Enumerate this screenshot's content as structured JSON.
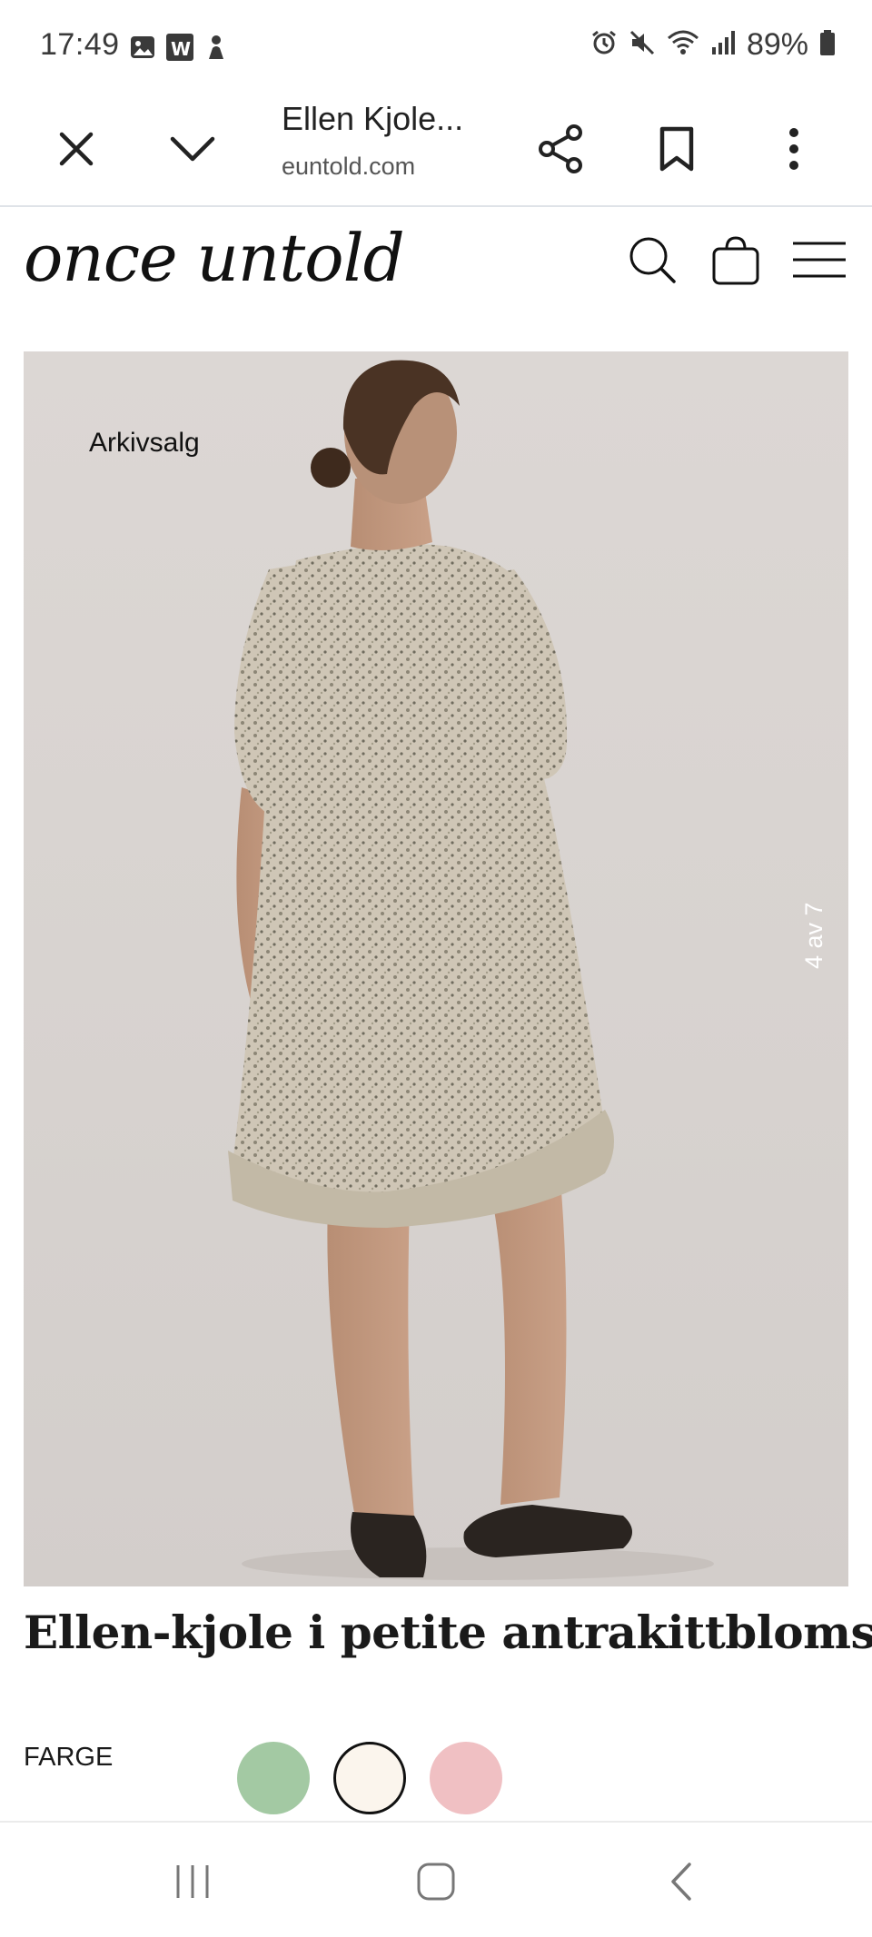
{
  "status_bar": {
    "time": "17:49",
    "left_icons": [
      "gallery-icon",
      "app-badge-icon",
      "activity-icon"
    ],
    "right_icons": [
      "alarm-icon",
      "mute-icon",
      "wifi-icon",
      "signal-icon",
      "battery-icon"
    ],
    "battery": "89%"
  },
  "browser": {
    "title": "Ellen Kjole...",
    "url": "euntold.com",
    "close_icon": "close-icon",
    "collapse_icon": "chevron-down-icon",
    "share_icon": "share-icon",
    "bookmark_icon": "bookmark-icon",
    "menu_icon": "more-vert-icon"
  },
  "site": {
    "logo": "once untold",
    "icons": [
      "search-icon",
      "bag-icon",
      "menu-icon"
    ]
  },
  "product": {
    "badge": "Arkivsalg",
    "slide_counter": "4 av 7",
    "title": "Ellen-kjole i petite antrakittblomst",
    "color_label": "FARGE",
    "swatches": [
      {
        "color": "#a3c9a3",
        "selected": false
      },
      {
        "color": "#fbf5ed",
        "selected": true
      },
      {
        "color": "#f0c0c3",
        "selected": false
      }
    ]
  },
  "nav_bar": {
    "icons": [
      "recent-apps-icon",
      "home-icon",
      "back-icon"
    ]
  }
}
